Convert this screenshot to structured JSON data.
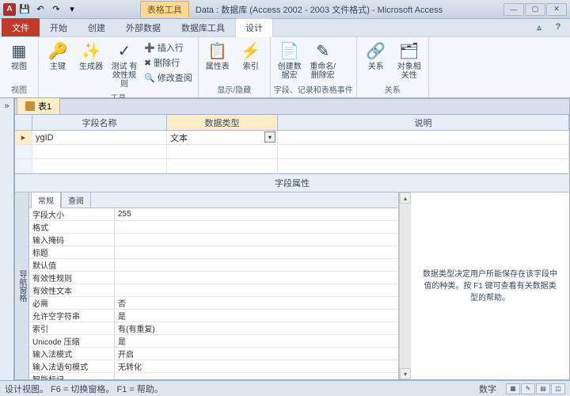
{
  "title": {
    "context_tab": "表格工具",
    "text": "Data : 数据库 (Access 2002 - 2003 文件格式) - Microsoft Access"
  },
  "ribbon_tabs": {
    "file": "文件",
    "home": "开始",
    "create": "创建",
    "external": "外部数据",
    "dbtools": "数据库工具",
    "design": "设计"
  },
  "ribbon": {
    "views": {
      "view": "视图",
      "group": "视图"
    },
    "tools": {
      "pk": "主键",
      "builder": "生成器",
      "test": "测试\n有效性规则",
      "insert_row": "插入行",
      "delete_row": "删除行",
      "modify_lookup": "修改查阅",
      "group": "工具"
    },
    "showhide": {
      "propsheet": "属性表",
      "indexes": "索引",
      "group": "显示/隐藏"
    },
    "events": {
      "create_macro": "创建数据宏",
      "rename": "重命名/\n删除宏",
      "group": "字段、记录和表格事件"
    },
    "rel": {
      "relationships": "关系",
      "deps": "对象相关性",
      "group": "关系"
    }
  },
  "doc_tab": "表1",
  "grid": {
    "col_field": "字段名称",
    "col_type": "数据类型",
    "col_desc": "说明",
    "row1": {
      "name": "ygID",
      "type": "文本"
    }
  },
  "field_props_title": "字段属性",
  "side_label": "导航窗格",
  "prop_tabs": {
    "general": "常规",
    "lookup": "查阅"
  },
  "props": [
    {
      "name": "字段大小",
      "value": "255"
    },
    {
      "name": "格式",
      "value": ""
    },
    {
      "name": "输入掩码",
      "value": ""
    },
    {
      "name": "标题",
      "value": ""
    },
    {
      "name": "默认值",
      "value": ""
    },
    {
      "name": "有效性规则",
      "value": ""
    },
    {
      "name": "有效性文本",
      "value": ""
    },
    {
      "name": "必需",
      "value": "否"
    },
    {
      "name": "允许空字符串",
      "value": "是"
    },
    {
      "name": "索引",
      "value": "有(有重复)"
    },
    {
      "name": "Unicode 压缩",
      "value": "是"
    },
    {
      "name": "输入法模式",
      "value": "开启"
    },
    {
      "name": "输入法语句模式",
      "value": "无转化"
    },
    {
      "name": "智能标记",
      "value": ""
    }
  ],
  "help_text": "数据类型决定用户所能保存在该字段中值的种类。按 F1 键可查看有关数据类型的帮助。",
  "status": {
    "left": "设计视图。  F6 = 切换窗格。  F1 = 帮助。",
    "mode": "数字"
  }
}
